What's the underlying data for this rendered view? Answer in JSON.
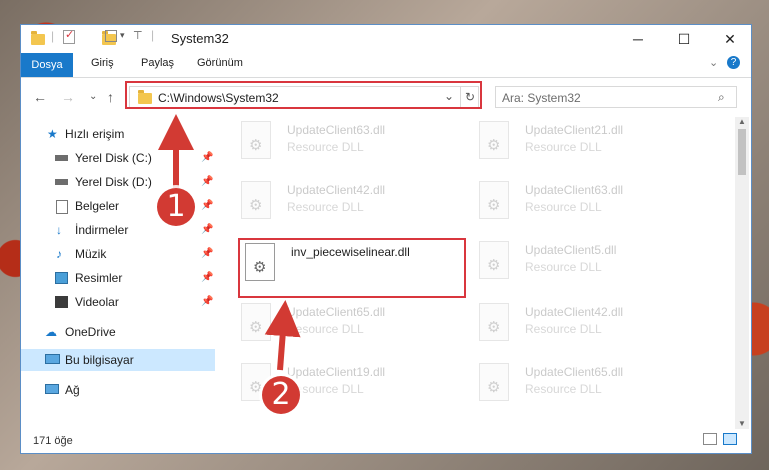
{
  "window": {
    "title": "System32"
  },
  "ribbon": {
    "tabs": [
      "Dosya",
      "Giriş",
      "Paylaş",
      "Görünüm"
    ]
  },
  "address": {
    "path": "C:\\Windows\\System32"
  },
  "search": {
    "placeholder": "Ara: System32"
  },
  "sidebar": {
    "quick_access": "Hızlı erişim",
    "items": [
      {
        "label": "Yerel Disk (C:)",
        "icon": "drive-icon"
      },
      {
        "label": "Yerel Disk (D:)",
        "icon": "drive-icon"
      },
      {
        "label": "Belgeler",
        "icon": "documents-icon"
      },
      {
        "label": "İndirmeler",
        "icon": "download-icon"
      },
      {
        "label": "Müzik",
        "icon": "music-icon"
      },
      {
        "label": "Resimler",
        "icon": "pictures-icon"
      },
      {
        "label": "Videolar",
        "icon": "video-icon"
      }
    ],
    "onedrive": "OneDrive",
    "this_pc": "Bu bilgisayar",
    "network": "Ağ"
  },
  "files": {
    "left": [
      {
        "name": "UpdateClient63.dll",
        "type": "Resource DLL"
      },
      {
        "name": "UpdateClient42.dll",
        "type": "Resource DLL"
      },
      {
        "name": "inv_piecewiselinear.dll",
        "type": ""
      },
      {
        "name": "UpdateClient65.dll",
        "type": "Resource DLL"
      },
      {
        "name": "UpdateClient19.dll",
        "type": "Resource DLL"
      }
    ],
    "right": [
      {
        "name": "UpdateClient21.dll",
        "type": "Resource DLL"
      },
      {
        "name": "UpdateClient63.dll",
        "type": "Resource DLL"
      },
      {
        "name": "UpdateClient5.dll",
        "type": "Resource DLL"
      },
      {
        "name": "UpdateClient42.dll",
        "type": "Resource DLL"
      },
      {
        "name": "UpdateClient65.dll",
        "type": "Resource DLL"
      }
    ]
  },
  "status": {
    "count": "171 öğe"
  },
  "annotations": {
    "marker1": "1",
    "marker2": "2"
  },
  "colors": {
    "accent": "#1979ca",
    "highlight": "#d9363e",
    "selection": "#cce8ff"
  }
}
